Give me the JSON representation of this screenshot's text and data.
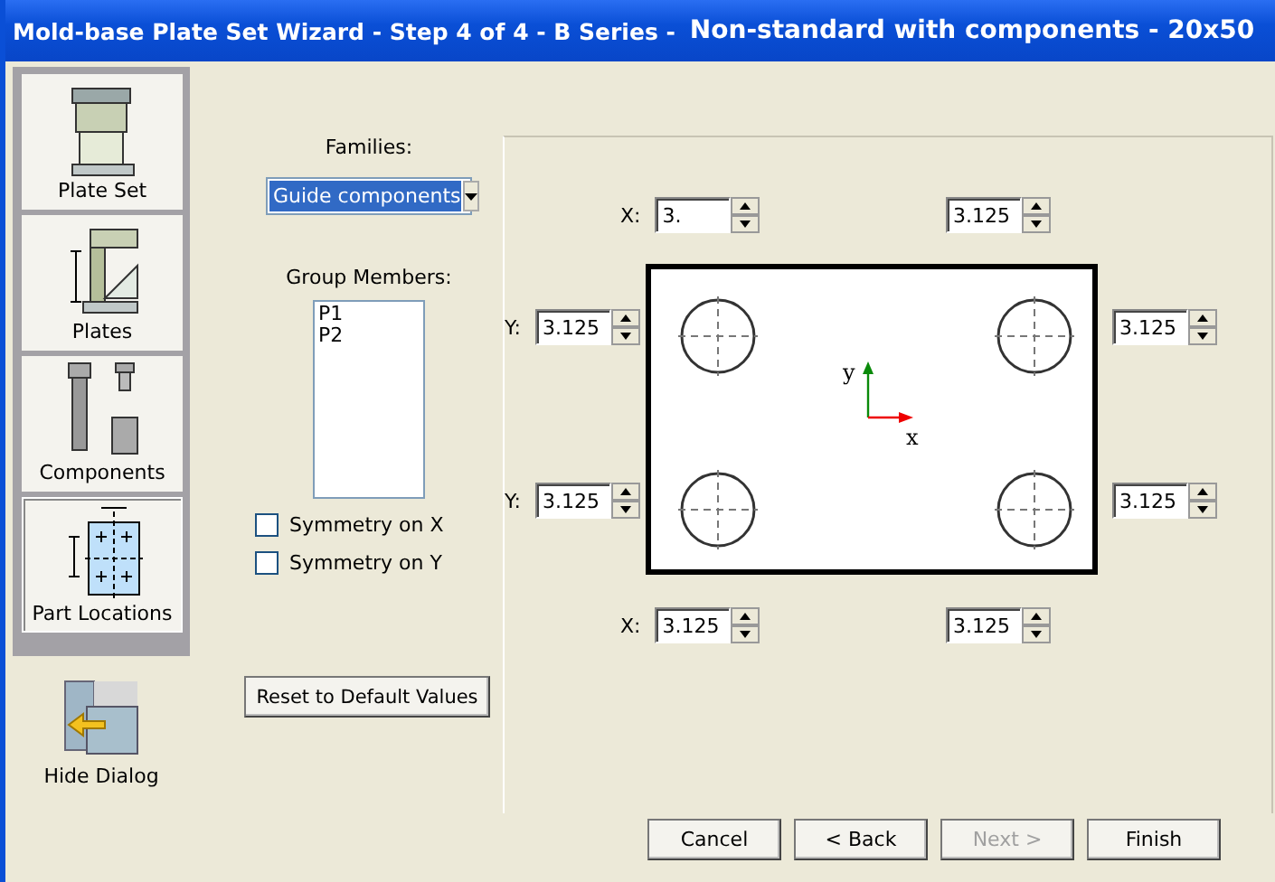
{
  "window": {
    "title": "Mold-base Plate Set Wizard - Step 4 of 4  - B Series -",
    "subtitle": "Non-standard with components - 20x50"
  },
  "nav": [
    {
      "kind": "plate_set",
      "label": "Plate Set",
      "selected": false
    },
    {
      "kind": "plates",
      "label": "Plates",
      "selected": false
    },
    {
      "kind": "components",
      "label": "Components",
      "selected": false
    },
    {
      "kind": "part_locations",
      "label": "Part Locations",
      "selected": true
    }
  ],
  "hide_dialog": {
    "label": "Hide Dialog"
  },
  "families": {
    "label": "Families:",
    "value": "Guide components"
  },
  "group_members": {
    "label": "Group Members:",
    "items": [
      "P1",
      "P2"
    ]
  },
  "checkboxes": [
    {
      "label": "Symmetry on X",
      "checked": false
    },
    {
      "label": "Symmetry on Y",
      "checked": false
    }
  ],
  "reset_button": "Reset to Default Values",
  "position_fields": {
    "top": [
      {
        "label": "X:",
        "value": "3."
      },
      {
        "value": "3.125"
      }
    ],
    "left": [
      {
        "label": "Y:",
        "value": "3.125"
      },
      {
        "label": "Y:",
        "value": "3.125"
      }
    ],
    "right": [
      {
        "value": "3.125"
      },
      {
        "value": "3.125"
      }
    ],
    "bottom": [
      {
        "label": "X:",
        "value": "3.125"
      },
      {
        "value": "3.125"
      }
    ]
  },
  "axis_labels": {
    "x": "x",
    "y": "y"
  },
  "buttons": [
    {
      "label": "Cancel",
      "disabled": false
    },
    {
      "label": "< Back",
      "disabled": false
    },
    {
      "label": "Next >",
      "disabled": true
    },
    {
      "label": "Finish",
      "disabled": false
    }
  ]
}
